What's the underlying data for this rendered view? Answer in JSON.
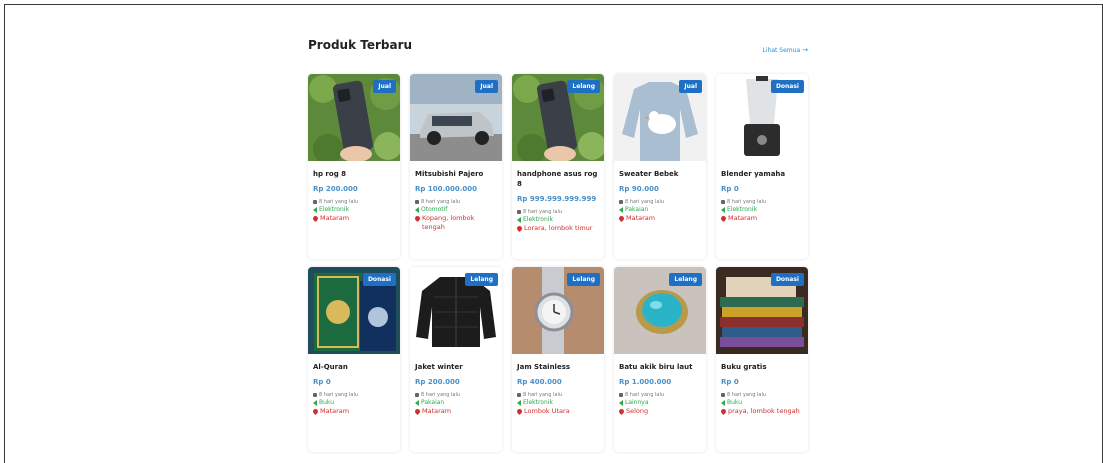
{
  "section": {
    "title": "Produk Terbaru",
    "see_all": "Lihat Semua",
    "see_all_icon": "arrow-right-icon"
  },
  "products": [
    {
      "name": "hp rog 8",
      "price": "Rp 200.000",
      "badge": "Jual",
      "posted": "8 hari yang lalu",
      "category": "Elektronik",
      "location": "Mataram",
      "image": "phone-photo"
    },
    {
      "name": "Mitsubishi Pajero",
      "price": "Rp 100.000.000",
      "badge": "Jual",
      "posted": "8 hari yang lalu",
      "category": "Otomotif",
      "location": "Kopang, lombok tengah",
      "image": "car-photo"
    },
    {
      "name": "handphone asus rog 8",
      "price": "Rp 999.999.999.999",
      "badge": "Lelang",
      "posted": "8 hari yang lalu",
      "category": "Elektronik",
      "location": "Lorara, lombok timur",
      "image": "phone-photo"
    },
    {
      "name": "Sweater Bebek",
      "price": "Rp 90.000",
      "badge": "Jual",
      "posted": "8 hari yang lalu",
      "category": "Pakaian",
      "location": "Mataram",
      "image": "sweater-photo"
    },
    {
      "name": "Blender yamaha",
      "price": "Rp 0",
      "badge": "Donasi",
      "posted": "8 hari yang lalu",
      "category": "Elektronik",
      "location": "Mataram",
      "image": "blender-photo"
    },
    {
      "name": "Al-Quran",
      "price": "Rp 0",
      "badge": "Donasi",
      "posted": "8 hari yang lalu",
      "category": "Buku",
      "location": "Mataram",
      "image": "quran-photo"
    },
    {
      "name": "Jaket winter",
      "price": "Rp 200.000",
      "badge": "Lelang",
      "posted": "8 hari yang lalu",
      "category": "Pakaian",
      "location": "Mataram",
      "image": "jacket-photo"
    },
    {
      "name": "Jam Stainless",
      "price": "Rp 400.000",
      "badge": "Lelang",
      "posted": "8 hari yang lalu",
      "category": "Elektronik",
      "location": "Lombok Utara",
      "image": "watch-photo"
    },
    {
      "name": "Batu akik biru laut",
      "price": "Rp 1.000.000",
      "badge": "Lelang",
      "posted": "8 hari yang lalu",
      "category": "Lainnya",
      "location": "Selong",
      "image": "ring-photo"
    },
    {
      "name": "Buku gratis",
      "price": "Rp 0",
      "badge": "Donasi",
      "posted": "8 hari yang lalu",
      "category": "Buku",
      "location": "praya, lombok tengah",
      "image": "books-photo"
    }
  ],
  "colors": {
    "badge": "#1f6fc5",
    "price": "#4a90c8",
    "category": "#2fa84f",
    "location": "#d32f2f",
    "link": "#2b8fd6"
  }
}
